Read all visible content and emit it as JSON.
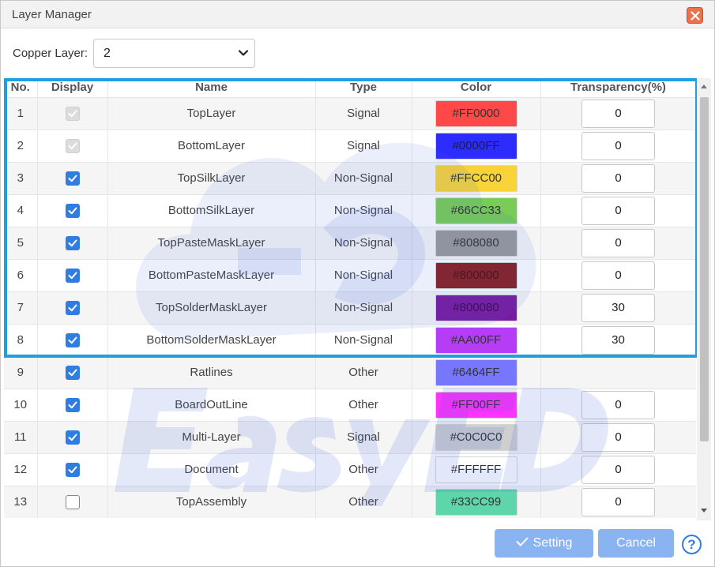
{
  "dialog": {
    "title": "Layer Manager"
  },
  "copper_layer": {
    "label": "Copper Layer:",
    "value": "2"
  },
  "table": {
    "headers": [
      "No.",
      "Display",
      "Name",
      "Type",
      "Color",
      "Transparency(%)"
    ],
    "rows": [
      {
        "no": "1",
        "display": "disabled",
        "name": "TopLayer",
        "type": "Signal",
        "color": "#FF0000",
        "swatch": "#ff4848",
        "text_color": "#333333",
        "transparency": "0"
      },
      {
        "no": "2",
        "display": "disabled",
        "name": "BottomLayer",
        "type": "Signal",
        "color": "#0000FF",
        "swatch": "#2c2cff",
        "text_color": "#1a1a55",
        "transparency": "0"
      },
      {
        "no": "3",
        "display": "checked",
        "name": "TopSilkLayer",
        "type": "Non-Signal",
        "color": "#FFCC00",
        "swatch": "#f7d43a",
        "text_color": "#333333",
        "transparency": "0"
      },
      {
        "no": "4",
        "display": "checked",
        "name": "BottomSilkLayer",
        "type": "Non-Signal",
        "color": "#66CC33",
        "swatch": "#79cd56",
        "text_color": "#333333",
        "transparency": "0"
      },
      {
        "no": "5",
        "display": "checked",
        "name": "TopPasteMaskLayer",
        "type": "Non-Signal",
        "color": "#808080",
        "swatch": "#9a9a9a",
        "text_color": "#333333",
        "transparency": "0"
      },
      {
        "no": "6",
        "display": "checked",
        "name": "BottomPasteMaskLayer",
        "type": "Non-Signal",
        "color": "#800000",
        "swatch": "#8a2020",
        "text_color": "#4a1010",
        "transparency": "0"
      },
      {
        "no": "7",
        "display": "checked",
        "name": "TopSolderMaskLayer",
        "type": "Non-Signal",
        "color": "#800080",
        "swatch": "#7a1aa0",
        "text_color": "#3a0a4a",
        "transparency": "30"
      },
      {
        "no": "8",
        "display": "checked",
        "name": "BottomSolderMaskLayer",
        "type": "Non-Signal",
        "color": "#AA00FF",
        "swatch": "#b63df7",
        "text_color": "#333333",
        "transparency": "30"
      },
      {
        "no": "9",
        "display": "checked",
        "name": "Ratlines",
        "type": "Other",
        "color": "#6464FF",
        "swatch": "#7676ff",
        "text_color": "#333333",
        "transparency": ""
      },
      {
        "no": "10",
        "display": "checked",
        "name": "BoardOutLine",
        "type": "Other",
        "color": "#FF00FF",
        "swatch": "#ff33ff",
        "text_color": "#333333",
        "transparency": "0"
      },
      {
        "no": "11",
        "display": "checked",
        "name": "Multi-Layer",
        "type": "Signal",
        "color": "#C0C0C0",
        "swatch": "#cfcfcf",
        "text_color": "#333333",
        "transparency": "0"
      },
      {
        "no": "12",
        "display": "checked",
        "name": "Document",
        "type": "Other",
        "color": "#FFFFFF",
        "swatch": "#ffffff",
        "text_color": "#333333",
        "transparency": "0"
      },
      {
        "no": "13",
        "display": "unchecked",
        "name": "TopAssembly",
        "type": "Other",
        "color": "#33CC99",
        "swatch": "#5fd6aa",
        "text_color": "#333333",
        "transparency": "0"
      }
    ]
  },
  "buttons": {
    "setting": "Setting",
    "cancel": "Cancel",
    "help": "?"
  },
  "colors": {
    "highlight": "#1ca0e0",
    "accent": "#2f7de1",
    "close": "#e8734f"
  },
  "icons": {
    "close": "close-icon",
    "dropdown": "chevron-down-icon",
    "check": "check-icon",
    "help": "help-icon"
  }
}
